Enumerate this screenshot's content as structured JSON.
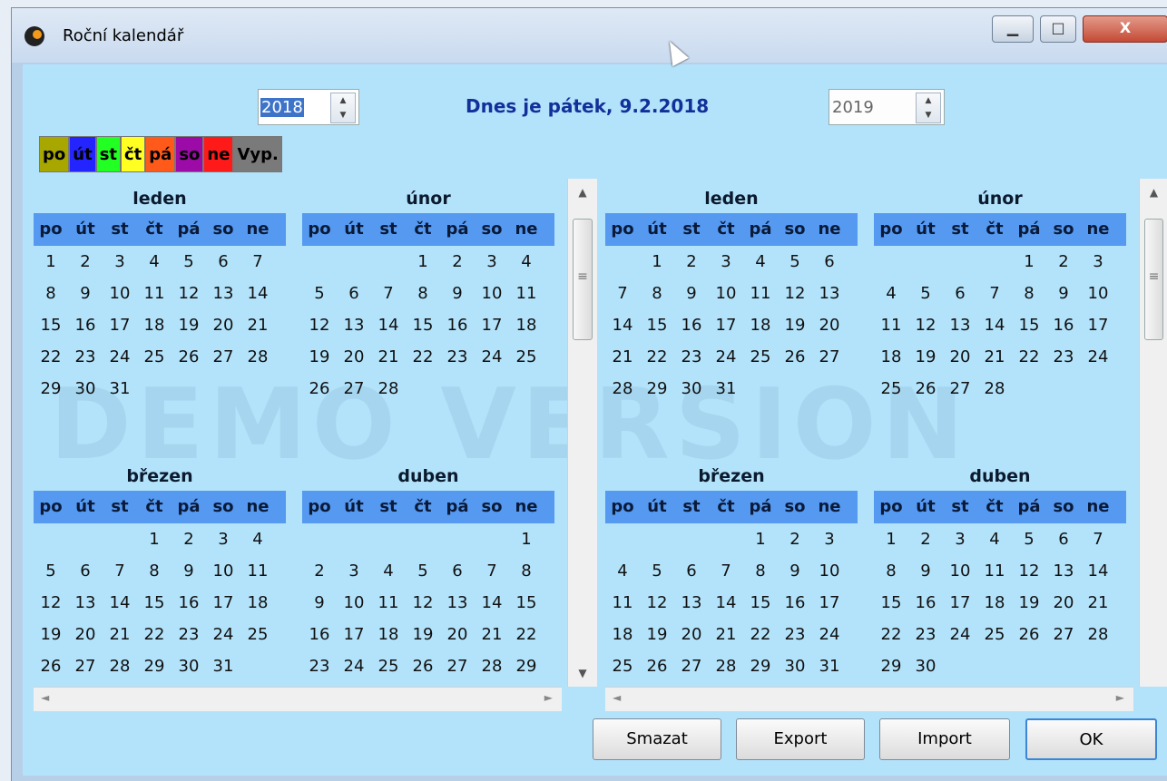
{
  "window": {
    "title": "Roční kalendář",
    "min_glyph": "▁",
    "max_glyph": "□",
    "close_glyph": "X"
  },
  "toolbar": {
    "year_left": "2018",
    "year_right": "2019",
    "today": "Dnes je pátek, 9.2.2018"
  },
  "legend": [
    {
      "label": "po",
      "color": "#a7a700"
    },
    {
      "label": "út",
      "color": "#2424ff"
    },
    {
      "label": "st",
      "color": "#22ff22"
    },
    {
      "label": "čt",
      "color": "#ffff22"
    },
    {
      "label": "pá",
      "color": "#ff5a1a"
    },
    {
      "label": "so",
      "color": "#9c0aa8"
    },
    {
      "label": "ne",
      "color": "#ff1a1a"
    },
    {
      "label": "Vyp.",
      "color": "#7a7a7a"
    }
  ],
  "watermark": "DEMO VERSION",
  "weekdays": [
    "po",
    "út",
    "st",
    "čt",
    "pá",
    "so",
    "ne"
  ],
  "calendars": [
    {
      "year": "2018",
      "months": [
        {
          "name": "leden",
          "rows": [
            [
              "1",
              "2",
              "3",
              "4",
              "5",
              "6",
              "7"
            ],
            [
              "8",
              "9",
              "10",
              "11",
              "12",
              "13",
              "14"
            ],
            [
              "15",
              "16",
              "17",
              "18",
              "19",
              "20",
              "21"
            ],
            [
              "22",
              "23",
              "24",
              "25",
              "26",
              "27",
              "28"
            ],
            [
              "29",
              "30",
              "31",
              "",
              "",
              "",
              ""
            ]
          ]
        },
        {
          "name": "únor",
          "rows": [
            [
              "",
              "",
              "",
              "1",
              "2",
              "3",
              "4"
            ],
            [
              "5",
              "6",
              "7",
              "8",
              "9",
              "10",
              "11"
            ],
            [
              "12",
              "13",
              "14",
              "15",
              "16",
              "17",
              "18"
            ],
            [
              "19",
              "20",
              "21",
              "22",
              "23",
              "24",
              "25"
            ],
            [
              "26",
              "27",
              "28",
              "",
              "",
              "",
              ""
            ]
          ]
        },
        {
          "name": "březen",
          "rows": [
            [
              "",
              "",
              "",
              "1",
              "2",
              "3",
              "4"
            ],
            [
              "5",
              "6",
              "7",
              "8",
              "9",
              "10",
              "11"
            ],
            [
              "12",
              "13",
              "14",
              "15",
              "16",
              "17",
              "18"
            ],
            [
              "19",
              "20",
              "21",
              "22",
              "23",
              "24",
              "25"
            ],
            [
              "26",
              "27",
              "28",
              "29",
              "30",
              "31",
              ""
            ]
          ]
        },
        {
          "name": "duben",
          "rows": [
            [
              "",
              "",
              "",
              "",
              "",
              "",
              "1"
            ],
            [
              "2",
              "3",
              "4",
              "5",
              "6",
              "7",
              "8"
            ],
            [
              "9",
              "10",
              "11",
              "12",
              "13",
              "14",
              "15"
            ],
            [
              "16",
              "17",
              "18",
              "19",
              "20",
              "21",
              "22"
            ],
            [
              "23",
              "24",
              "25",
              "26",
              "27",
              "28",
              "29"
            ]
          ]
        }
      ]
    },
    {
      "year": "2019",
      "months": [
        {
          "name": "leden",
          "rows": [
            [
              "",
              "1",
              "2",
              "3",
              "4",
              "5",
              "6"
            ],
            [
              "7",
              "8",
              "9",
              "10",
              "11",
              "12",
              "13"
            ],
            [
              "14",
              "15",
              "16",
              "17",
              "18",
              "19",
              "20"
            ],
            [
              "21",
              "22",
              "23",
              "24",
              "25",
              "26",
              "27"
            ],
            [
              "28",
              "29",
              "30",
              "31",
              "",
              "",
              ""
            ]
          ]
        },
        {
          "name": "únor",
          "rows": [
            [
              "",
              "",
              "",
              "",
              "1",
              "2",
              "3"
            ],
            [
              "4",
              "5",
              "6",
              "7",
              "8",
              "9",
              "10"
            ],
            [
              "11",
              "12",
              "13",
              "14",
              "15",
              "16",
              "17"
            ],
            [
              "18",
              "19",
              "20",
              "21",
              "22",
              "23",
              "24"
            ],
            [
              "25",
              "26",
              "27",
              "28",
              "",
              "",
              ""
            ]
          ]
        },
        {
          "name": "březen",
          "rows": [
            [
              "",
              "",
              "",
              "",
              "1",
              "2",
              "3"
            ],
            [
              "4",
              "5",
              "6",
              "7",
              "8",
              "9",
              "10"
            ],
            [
              "11",
              "12",
              "13",
              "14",
              "15",
              "16",
              "17"
            ],
            [
              "18",
              "19",
              "20",
              "21",
              "22",
              "23",
              "24"
            ],
            [
              "25",
              "26",
              "27",
              "28",
              "29",
              "30",
              "31"
            ]
          ]
        },
        {
          "name": "duben",
          "rows": [
            [
              "1",
              "2",
              "3",
              "4",
              "5",
              "6",
              "7"
            ],
            [
              "8",
              "9",
              "10",
              "11",
              "12",
              "13",
              "14"
            ],
            [
              "15",
              "16",
              "17",
              "18",
              "19",
              "20",
              "21"
            ],
            [
              "22",
              "23",
              "24",
              "25",
              "26",
              "27",
              "28"
            ],
            [
              "29",
              "30",
              "",
              "",
              "",
              "",
              ""
            ]
          ]
        }
      ]
    }
  ],
  "buttons": {
    "delete": "Smazat",
    "export": "Export",
    "import": "Import",
    "ok": "OK"
  },
  "scroll": {
    "up": "▲",
    "down": "▼",
    "left": "◄",
    "right": "►",
    "grip": "≡"
  }
}
